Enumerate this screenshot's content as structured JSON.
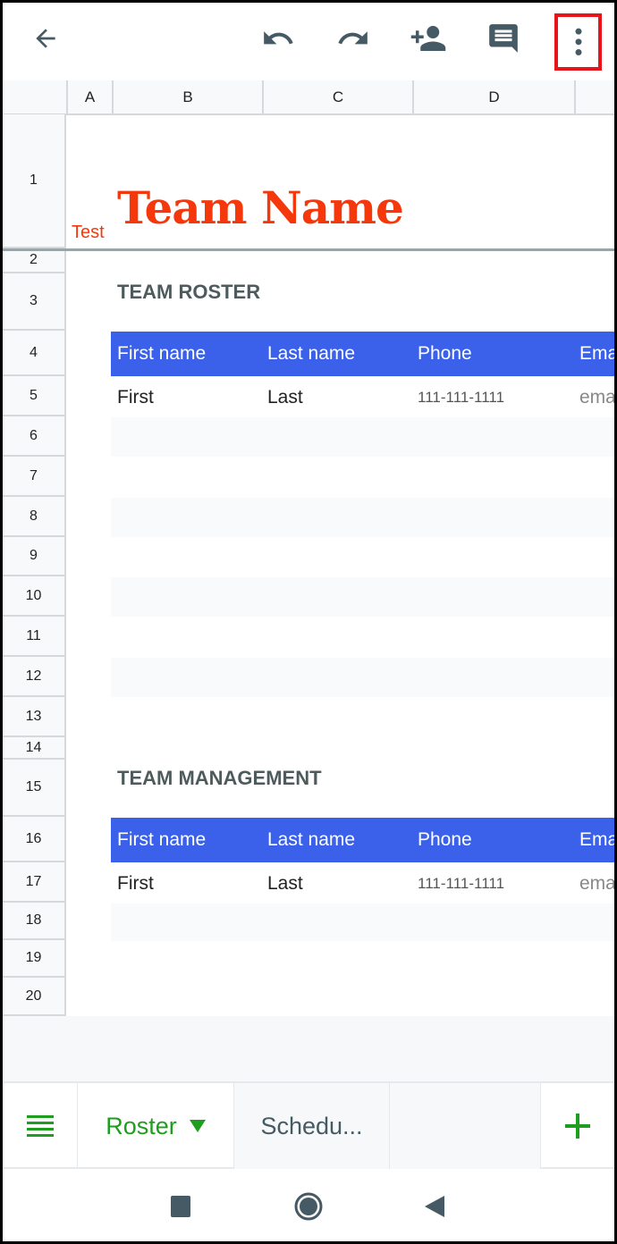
{
  "toolbar": {
    "icons": [
      "back-arrow-icon",
      "undo-icon",
      "redo-icon",
      "add-person-icon",
      "comment-icon",
      "more-vert-icon"
    ],
    "highlight_color": "#e8141b"
  },
  "columns": [
    "A",
    "B",
    "C",
    "D"
  ],
  "rows": [
    "1",
    "2",
    "3",
    "4",
    "5",
    "6",
    "7",
    "8",
    "9",
    "10",
    "11",
    "12",
    "13",
    "14",
    "15",
    "16",
    "17",
    "18",
    "19",
    "20"
  ],
  "sheet": {
    "test_label": "Test",
    "title": "Team Name",
    "roster": {
      "heading": "TEAM ROSTER",
      "headers": [
        "First name",
        "Last name",
        "Phone",
        "Ema"
      ],
      "row": [
        "First",
        "Last",
        "111-111-1111",
        "ema"
      ]
    },
    "management": {
      "heading": "TEAM MANAGEMENT",
      "headers": [
        "First name",
        "Last name",
        "Phone",
        "Ema"
      ],
      "row": [
        "First",
        "Last",
        "111-111-1111",
        "ema"
      ]
    },
    "header_color": "#3b61ea",
    "title_color": "#f4380b"
  },
  "tabs": {
    "active": "Roster",
    "other": "Schedu...",
    "accent": "#1e9e1e"
  },
  "nav": {
    "icons": [
      "recents-square-icon",
      "home-circle-icon",
      "back-triangle-icon"
    ]
  }
}
